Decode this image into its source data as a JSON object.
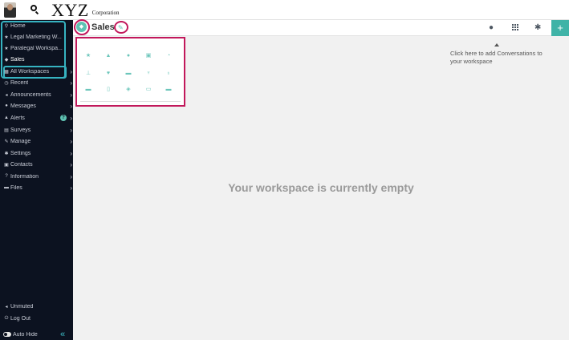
{
  "topbar": {
    "logo_main": "XYZ",
    "logo_sub": "Corporation",
    "avatar_icon": "user-avatar",
    "search_icon": "search-icon"
  },
  "sidebar": {
    "items": [
      {
        "label": "Home",
        "icon": "map-pin-icon",
        "glyph": "⚲"
      },
      {
        "label": "Legal Marketing W...",
        "icon": "star-icon",
        "glyph": "★"
      },
      {
        "label": "Paralegal Workspa...",
        "icon": "star-icon",
        "glyph": "★"
      },
      {
        "label": "Sales",
        "icon": "layers-icon",
        "glyph": "◆"
      },
      {
        "label": "All Workspaces",
        "icon": "grid-icon",
        "glyph": "▦"
      },
      {
        "label": "Recent",
        "icon": "clock-icon",
        "glyph": "◷"
      },
      {
        "label": "Announcements",
        "icon": "megaphone-icon",
        "glyph": "◂"
      },
      {
        "label": "Messages",
        "icon": "chat-icon",
        "glyph": "●"
      },
      {
        "label": "Alerts",
        "icon": "warning-icon",
        "glyph": "▲",
        "badge": "?"
      },
      {
        "label": "Surveys",
        "icon": "clipboard-icon",
        "glyph": "▤"
      },
      {
        "label": "Manage",
        "icon": "pencil-icon",
        "glyph": "✎"
      },
      {
        "label": "Settings",
        "icon": "gear-icon",
        "glyph": "✱"
      },
      {
        "label": "Contacts",
        "icon": "contacts-icon",
        "glyph": "▣"
      },
      {
        "label": "Information",
        "icon": "help-icon",
        "glyph": "?"
      },
      {
        "label": "Files",
        "icon": "folder-icon",
        "glyph": "▬"
      }
    ],
    "bottom": {
      "unmuted": "Unmuted",
      "logout": "Log Out",
      "autohide": "Auto Hide",
      "collapse_glyph": "«"
    }
  },
  "header": {
    "title": "Sales",
    "workspace_icon": "layers-icon",
    "edit_icon": "pencil-icon",
    "right_icons": [
      "conversation-icon",
      "apps-grid-icon",
      "gear-icon"
    ],
    "add_label": "+"
  },
  "picker": {
    "icons": [
      [
        "star-icon",
        "graduation-cap-icon",
        "badge-icon",
        "portrait-icon",
        "pie-chart-icon"
      ],
      [
        "pin-icon",
        "heart-icon",
        "briefcase-icon",
        "trophy-icon",
        "award-icon"
      ],
      [
        "calendar-icon",
        "clipboard-icon",
        "network-icon",
        "image-icon",
        "message-icon"
      ]
    ],
    "glyphs": [
      [
        "★",
        "▲",
        "●",
        "▣",
        "◔"
      ],
      [
        "⊥",
        "♥",
        "▬",
        "♆",
        "♁"
      ],
      [
        "▬",
        "▯",
        "◈",
        "▭",
        "▬"
      ]
    ]
  },
  "hint": "Click here to add Conversations to your workspace",
  "empty_message": "Your workspace is currently empty",
  "colors": {
    "sidebar_bg": "#0c1220",
    "accent_teal": "#3fb3a7",
    "highlight_cyan": "#36b3c1",
    "annotation_red": "#c2185b"
  }
}
